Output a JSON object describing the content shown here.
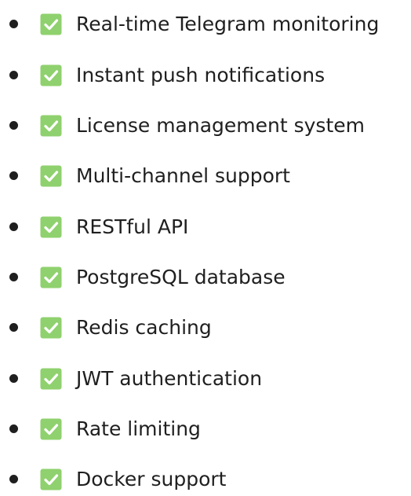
{
  "features": {
    "check_color": "#8fd16e",
    "check_mark_color": "#ffffff",
    "items": [
      {
        "label": "Real-time Telegram monitoring",
        "icon": "check-box-icon"
      },
      {
        "label": "Instant push notifications",
        "icon": "check-box-icon"
      },
      {
        "label": "License management system",
        "icon": "check-box-icon"
      },
      {
        "label": "Multi-channel support",
        "icon": "check-box-icon"
      },
      {
        "label": "RESTful API",
        "icon": "check-box-icon"
      },
      {
        "label": "PostgreSQL database",
        "icon": "check-box-icon"
      },
      {
        "label": "Redis caching",
        "icon": "check-box-icon"
      },
      {
        "label": "JWT authentication",
        "icon": "check-box-icon"
      },
      {
        "label": "Rate limiting",
        "icon": "check-box-icon"
      },
      {
        "label": "Docker support",
        "icon": "check-box-icon"
      }
    ]
  }
}
